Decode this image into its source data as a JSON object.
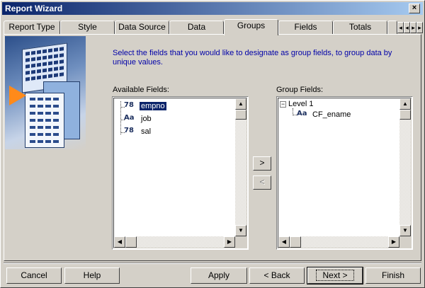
{
  "window": {
    "title": "Report Wizard",
    "close_label": "×"
  },
  "tabs": [
    {
      "label": "Report Type"
    },
    {
      "label": "Style"
    },
    {
      "label": "Data Source"
    },
    {
      "label": "Data"
    },
    {
      "label": "Groups",
      "active": true
    },
    {
      "label": "Fields"
    },
    {
      "label": "Totals"
    }
  ],
  "instructions": "Select the fields that you would like to designate as group fields, to group data by unique values.",
  "available": {
    "label": "Available Fields:",
    "items": [
      {
        "icon": "number-field-icon",
        "glyph": "78",
        "name": "empno",
        "selected": true
      },
      {
        "icon": "text-field-icon",
        "glyph": "Aa",
        "name": "job"
      },
      {
        "icon": "number-field-icon",
        "glyph": "78",
        "name": "sal"
      }
    ]
  },
  "groups": {
    "label": "Group Fields:",
    "level": "Level 1",
    "level_toggle": "−",
    "items": [
      {
        "icon": "text-field-icon",
        "glyph": "Aa",
        "name": "CF_ename"
      }
    ]
  },
  "move": {
    "right": ">",
    "left": "<"
  },
  "buttons": {
    "cancel": "Cancel",
    "help": "Help",
    "apply": "Apply",
    "back": "< Back",
    "next": "Next >",
    "finish": "Finish"
  },
  "colors": {
    "title_bar": "#0a246a",
    "instructions": "#0000a8",
    "selection": "#0a246a",
    "arrow": "#ff8a1a"
  }
}
